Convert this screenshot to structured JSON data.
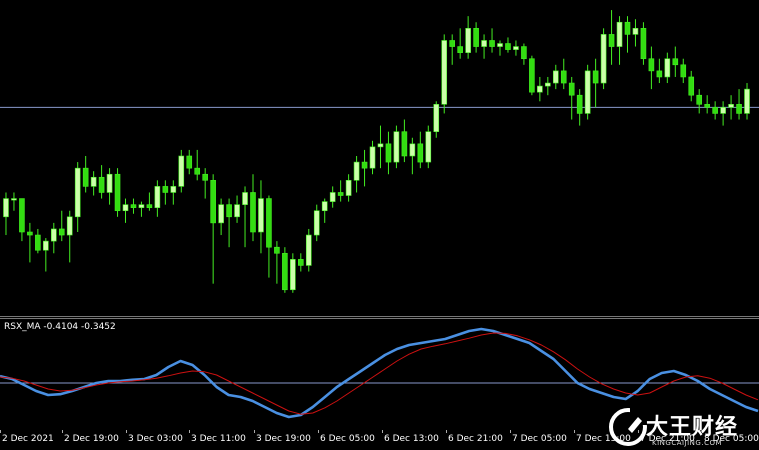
{
  "indicator": {
    "label": "RSX_MA -0.4104 -0.3452"
  },
  "time_axis": {
    "labels": [
      "2 Dec 2021",
      "2 Dec 19:00",
      "3 Dec 03:00",
      "3 Dec 11:00",
      "3 Dec 19:00",
      "6 Dec 05:00",
      "6 Dec 13:00",
      "6 Dec 21:00",
      "7 Dec 05:00",
      "7 Dec 13:00",
      "7 Dec 21:00",
      "8 Dec 05:00"
    ]
  },
  "watermark": {
    "name": "大王财经",
    "url": "KINGCAIJING.COM"
  },
  "colors": {
    "background": "#000000",
    "bull_candle": "#ccffaa",
    "bear_candle": "#33dd11",
    "wick": "#44ee22",
    "rsx_line": "#4a90e2",
    "ma_line": "#cc1111",
    "level_line": "#8899cc"
  },
  "chart_data": [
    {
      "type": "candlestick",
      "price_range": [
        0,
        100
      ],
      "horizontal_level": 66,
      "candles": [
        [
          30,
          38,
          24,
          36
        ],
        [
          36,
          38,
          32,
          36
        ],
        [
          36,
          36,
          22,
          25
        ],
        [
          25,
          28,
          15,
          24
        ],
        [
          24,
          26,
          18,
          19
        ],
        [
          19,
          23,
          12,
          22
        ],
        [
          22,
          28,
          18,
          26
        ],
        [
          26,
          32,
          22,
          24
        ],
        [
          24,
          32,
          15,
          30
        ],
        [
          30,
          48,
          25,
          46
        ],
        [
          46,
          50,
          38,
          40
        ],
        [
          40,
          45,
          37,
          43
        ],
        [
          43,
          47,
          36,
          38
        ],
        [
          38,
          46,
          34,
          44
        ],
        [
          44,
          46,
          30,
          32
        ],
        [
          32,
          36,
          28,
          34
        ],
        [
          34,
          36,
          31,
          33
        ],
        [
          33,
          35,
          30,
          34
        ],
        [
          34,
          38,
          32,
          33
        ],
        [
          33,
          42,
          30,
          40
        ],
        [
          40,
          42,
          34,
          38
        ],
        [
          38,
          42,
          34,
          40
        ],
        [
          40,
          52,
          38,
          50
        ],
        [
          50,
          52,
          44,
          46
        ],
        [
          46,
          52,
          42,
          44
        ],
        [
          44,
          46,
          36,
          42
        ],
        [
          42,
          44,
          8,
          28
        ],
        [
          28,
          36,
          24,
          34
        ],
        [
          34,
          36,
          20,
          30
        ],
        [
          30,
          37,
          28,
          34
        ],
        [
          34,
          40,
          20,
          38
        ],
        [
          38,
          44,
          22,
          25
        ],
        [
          25,
          42,
          18,
          36
        ],
        [
          36,
          37,
          10,
          20
        ],
        [
          20,
          22,
          8,
          18
        ],
        [
          18,
          20,
          5,
          6
        ],
        [
          6,
          18,
          5,
          16
        ],
        [
          16,
          18,
          12,
          14
        ],
        [
          14,
          26,
          12,
          24
        ],
        [
          24,
          34,
          22,
          32
        ],
        [
          32,
          36,
          28,
          35
        ],
        [
          35,
          40,
          33,
          38
        ],
        [
          38,
          42,
          35,
          37
        ],
        [
          37,
          44,
          35,
          42
        ],
        [
          42,
          50,
          38,
          48
        ],
        [
          48,
          52,
          40,
          46
        ],
        [
          46,
          55,
          44,
          53
        ],
        [
          53,
          60,
          46,
          54
        ],
        [
          54,
          58,
          44,
          48
        ],
        [
          48,
          60,
          46,
          58
        ],
        [
          58,
          62,
          48,
          50
        ],
        [
          50,
          56,
          44,
          54
        ],
        [
          54,
          58,
          46,
          48
        ],
        [
          48,
          60,
          46,
          58
        ],
        [
          58,
          68,
          56,
          67
        ],
        [
          67,
          90,
          64,
          88
        ],
        [
          88,
          90,
          80,
          86
        ],
        [
          86,
          92,
          82,
          84
        ],
        [
          84,
          96,
          82,
          92
        ],
        [
          92,
          94,
          84,
          86
        ],
        [
          86,
          90,
          82,
          88
        ],
        [
          88,
          92,
          84,
          86
        ],
        [
          86,
          88,
          83,
          87
        ],
        [
          87,
          89,
          84,
          85
        ],
        [
          85,
          88,
          83,
          86
        ],
        [
          86,
          87,
          80,
          82
        ],
        [
          82,
          83,
          70,
          71
        ],
        [
          71,
          76,
          68,
          73
        ],
        [
          73,
          76,
          70,
          74
        ],
        [
          74,
          80,
          72,
          78
        ],
        [
          78,
          82,
          72,
          74
        ],
        [
          74,
          76,
          62,
          70
        ],
        [
          70,
          72,
          60,
          64
        ],
        [
          64,
          80,
          62,
          78
        ],
        [
          78,
          82,
          66,
          74
        ],
        [
          74,
          92,
          72,
          90
        ],
        [
          90,
          98,
          80,
          86
        ],
        [
          86,
          96,
          80,
          94
        ],
        [
          94,
          96,
          84,
          90
        ],
        [
          90,
          95,
          86,
          92
        ],
        [
          92,
          94,
          80,
          82
        ],
        [
          82,
          86,
          72,
          78
        ],
        [
          78,
          82,
          74,
          76
        ],
        [
          76,
          84,
          74,
          82
        ],
        [
          82,
          86,
          76,
          80
        ],
        [
          80,
          82,
          74,
          76
        ],
        [
          76,
          78,
          68,
          70
        ],
        [
          70,
          72,
          64,
          67
        ],
        [
          67,
          70,
          64,
          66
        ],
        [
          66,
          68,
          62,
          64
        ],
        [
          64,
          68,
          60,
          66
        ],
        [
          66,
          70,
          62,
          67
        ],
        [
          67,
          72,
          62,
          64
        ],
        [
          64,
          74,
          62,
          72
        ]
      ]
    },
    {
      "type": "line",
      "series": [
        {
          "values": [
            0.17,
            0.1,
            -0.05,
            -0.2,
            -0.3,
            -0.28,
            -0.2,
            -0.1,
            0.0,
            0.05,
            0.05,
            0.08,
            0.1,
            0.2,
            0.4,
            0.55,
            0.45,
            0.2,
            -0.1,
            -0.3,
            -0.35,
            -0.45,
            -0.6,
            -0.75,
            -0.85,
            -0.8,
            -0.6,
            -0.35,
            -0.1,
            0.1,
            0.3,
            0.5,
            0.7,
            0.85,
            0.95,
            1.0,
            1.05,
            1.1,
            1.2,
            1.3,
            1.35,
            1.3,
            1.2,
            1.1,
            1.0,
            0.8,
            0.6,
            0.3,
            0.0,
            -0.15,
            -0.25,
            -0.35,
            -0.4,
            -0.2,
            0.1,
            0.25,
            0.3,
            0.2,
            0.05,
            -0.15,
            -0.3,
            -0.45,
            -0.6,
            -0.7
          ]
        },
        {
          "values": [
            0.15,
            0.12,
            0.05,
            -0.05,
            -0.15,
            -0.2,
            -0.18,
            -0.12,
            -0.05,
            0.0,
            0.03,
            0.05,
            0.08,
            0.12,
            0.18,
            0.25,
            0.3,
            0.28,
            0.2,
            0.05,
            -0.1,
            -0.25,
            -0.4,
            -0.55,
            -0.7,
            -0.78,
            -0.75,
            -0.62,
            -0.45,
            -0.25,
            -0.05,
            0.15,
            0.35,
            0.55,
            0.72,
            0.85,
            0.92,
            0.98,
            1.05,
            1.12,
            1.2,
            1.25,
            1.24,
            1.18,
            1.08,
            0.95,
            0.78,
            0.58,
            0.35,
            0.15,
            -0.02,
            -0.15,
            -0.25,
            -0.3,
            -0.25,
            -0.1,
            0.05,
            0.15,
            0.18,
            0.12,
            0.0,
            -0.15,
            -0.3,
            -0.42
          ]
        }
      ],
      "ylim": [
        -1.0,
        1.5
      ],
      "zero_level": 0
    }
  ]
}
